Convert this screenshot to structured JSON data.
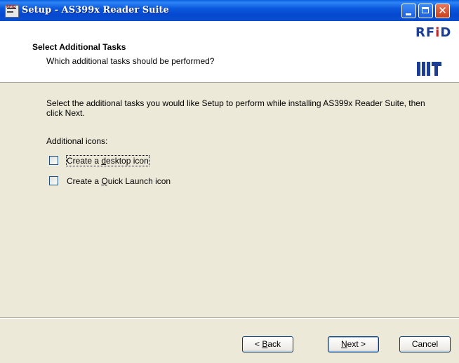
{
  "window": {
    "title": "Setup - AS399x Reader Suite"
  },
  "header": {
    "title": "Select Additional Tasks",
    "subtitle": "Which additional tasks should be performed?",
    "logo_text_main": "RF",
    "logo_text_i": "i",
    "logo_text_end": "D"
  },
  "body": {
    "instructions": "Select the additional tasks you would like Setup to perform while installing AS399x Reader Suite, then click Next.",
    "group_label": "Additional icons:",
    "tasks": [
      {
        "label_pre": "Create a ",
        "label_mnemonic": "d",
        "label_post": "esktop icon",
        "checked": false
      },
      {
        "label_pre": "Create a ",
        "label_mnemonic": "Q",
        "label_post": "uick Launch icon",
        "checked": false
      }
    ]
  },
  "buttons": {
    "back": {
      "pre": "< ",
      "mnemonic": "B",
      "post": "ack"
    },
    "next": {
      "pre": "",
      "mnemonic": "N",
      "post": "ext >"
    },
    "cancel": "Cancel"
  },
  "colors": {
    "titlebar": "#0b58dd",
    "dialog_bg": "#ece9d8",
    "logo_blue": "#1c3f94",
    "logo_red": "#c0262c"
  },
  "icons": [
    "app-icon",
    "minimize-icon",
    "maximize-icon",
    "close-icon"
  ]
}
